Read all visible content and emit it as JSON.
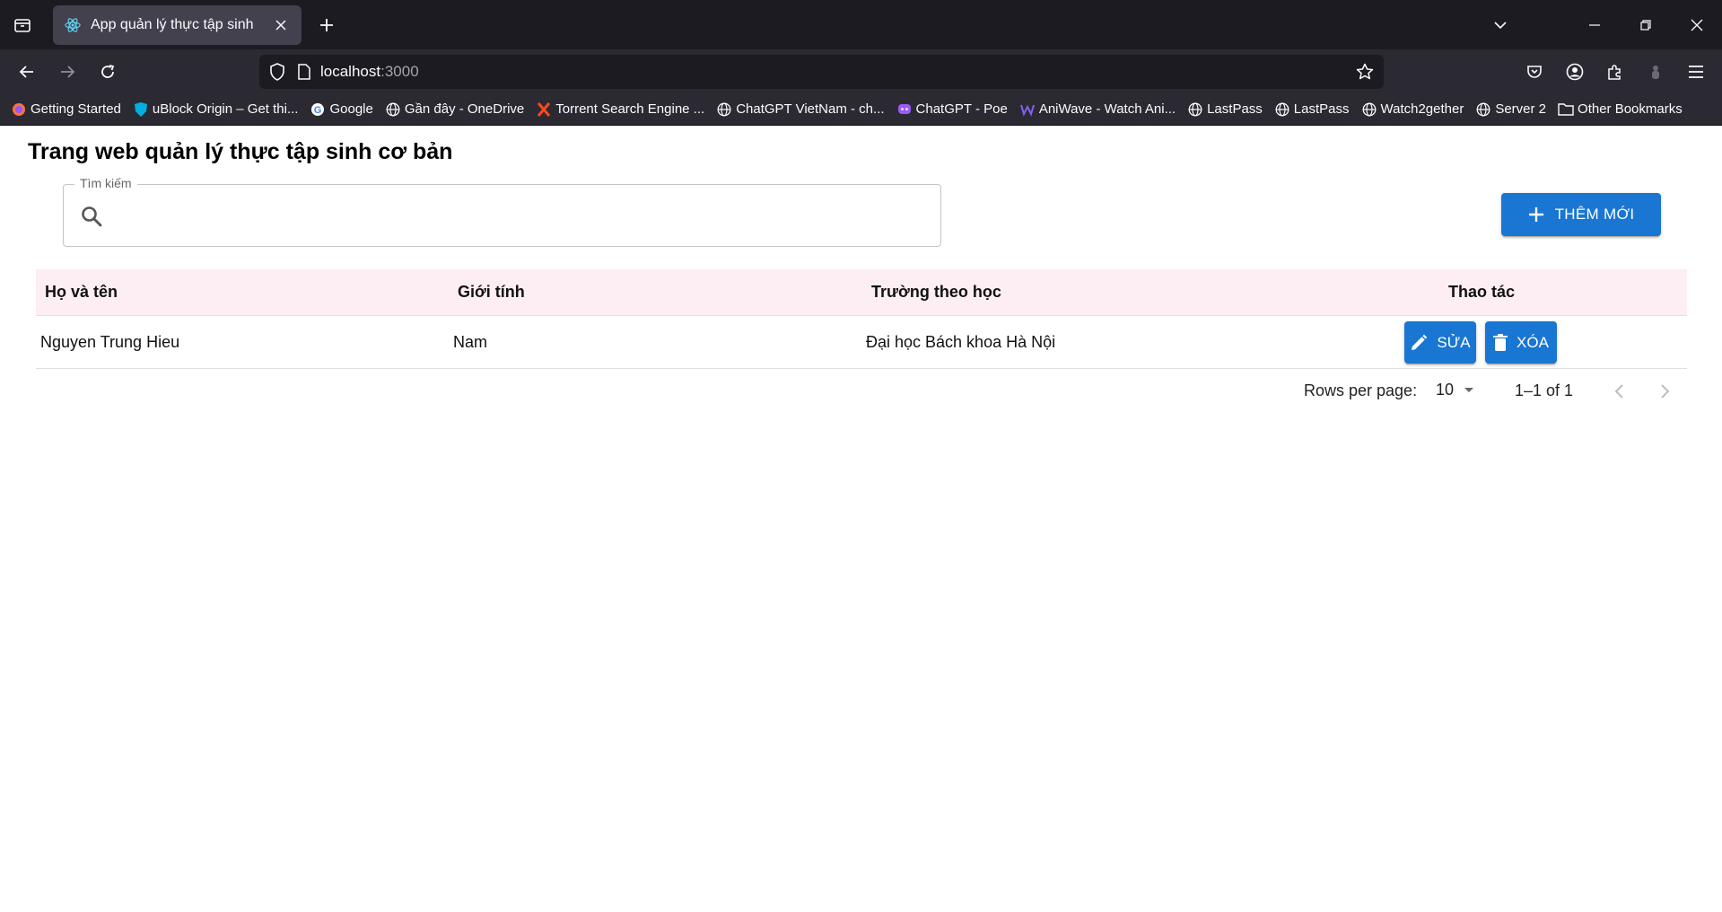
{
  "browser": {
    "tab": {
      "title": "App quản lý thực tập sinh"
    },
    "url": {
      "host": "localhost",
      "port": ":3000"
    },
    "bookmarks": [
      {
        "label": "Getting Started",
        "icon": "firefox-icon"
      },
      {
        "label": "uBlock Origin – Get thi...",
        "icon": "ublock-icon"
      },
      {
        "label": "Google",
        "icon": "google-icon"
      },
      {
        "label": "Gần đây - OneDrive",
        "icon": "globe-icon"
      },
      {
        "label": "Torrent Search Engine ...",
        "icon": "torrent-icon"
      },
      {
        "label": "ChatGPT VietNam - ch...",
        "icon": "globe-icon"
      },
      {
        "label": "ChatGPT - Poe",
        "icon": "poe-icon"
      },
      {
        "label": "AniWave - Watch Ani...",
        "icon": "aniwave-icon"
      },
      {
        "label": "LastPass",
        "icon": "globe-icon"
      },
      {
        "label": "LastPass",
        "icon": "globe-icon"
      },
      {
        "label": "Watch2gether",
        "icon": "globe-icon"
      },
      {
        "label": "Server 2",
        "icon": "globe-icon"
      },
      {
        "label": "Other Bookmarks",
        "icon": "folder-icon"
      }
    ]
  },
  "page": {
    "title": "Trang web quản lý thực tập sinh cơ bản",
    "search": {
      "legend": "Tìm kiếm",
      "value": "",
      "placeholder": ""
    },
    "add_button": "THÊM MỚI",
    "table": {
      "headers": [
        "Họ và tên",
        "Giới tính",
        "Trường theo học",
        "Thao tác"
      ],
      "rows": [
        {
          "name": "Nguyen Trung Hieu",
          "gender": "Nam",
          "school": "Đại học Bách khoa Hà Nội",
          "edit": "SỬA",
          "delete": "XÓA"
        }
      ]
    },
    "pagination": {
      "rows_label": "Rows per page:",
      "rows_value": "10",
      "range": "1–1 of 1"
    }
  },
  "colors": {
    "primary": "#1976d2",
    "header_bg": "#fdeef3"
  }
}
